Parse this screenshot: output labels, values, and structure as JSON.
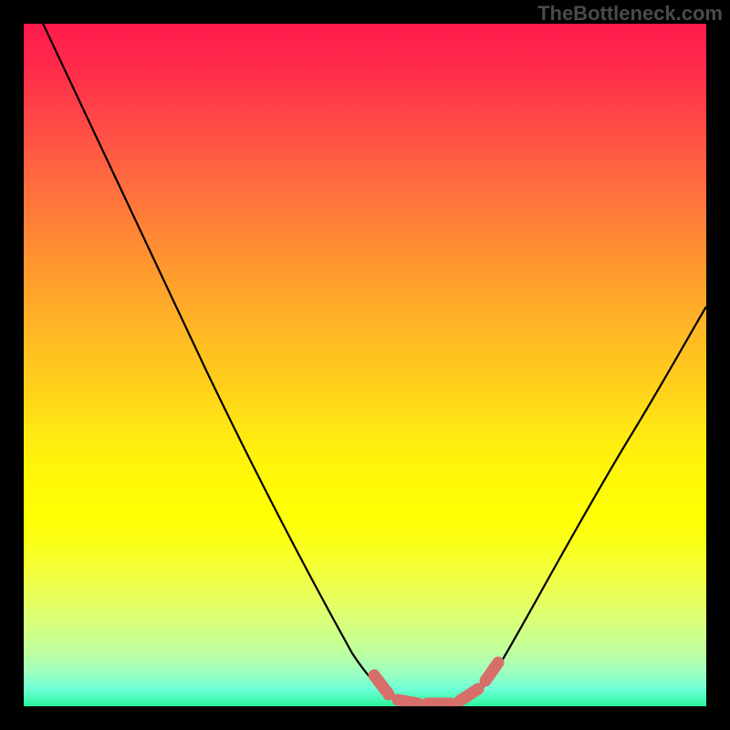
{
  "watermark": "TheBottleneck.com",
  "chart_data": {
    "type": "line",
    "title": "",
    "xlabel": "",
    "ylabel": "",
    "xlim": [
      0,
      100
    ],
    "ylim": [
      0,
      100
    ],
    "series": [
      {
        "name": "bottleneck-curve",
        "color": "#000000",
        "x": [
          0,
          10,
          20,
          30,
          40,
          50,
          53,
          56,
          60,
          63,
          66,
          70,
          80,
          90,
          100
        ],
        "y": [
          106,
          85,
          64,
          44,
          26,
          9,
          4,
          1.5,
          0.5,
          0.5,
          1.5,
          5,
          19,
          36,
          53
        ]
      },
      {
        "name": "optimal-markers",
        "color": "#d86e6a",
        "type": "scatter",
        "x": [
          53,
          56,
          60,
          63,
          66
        ],
        "y": [
          4,
          1.5,
          0.5,
          0.5,
          1.5
        ]
      }
    ],
    "background_gradient": {
      "top_color": "#ff1a4d",
      "mid_color": "#ffe912",
      "bottom_color": "#29f59a"
    }
  }
}
